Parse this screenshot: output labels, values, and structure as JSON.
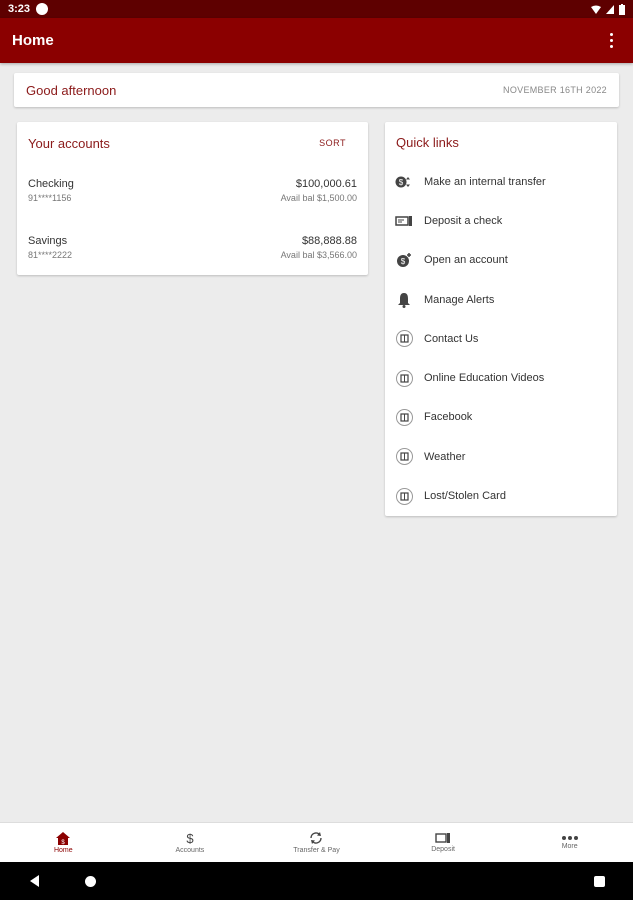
{
  "status": {
    "time": "3:23"
  },
  "app_bar": {
    "title": "Home"
  },
  "greeting": {
    "text": "Good afternoon",
    "date": "NOVEMBER 16TH 2022"
  },
  "accounts": {
    "title": "Your accounts",
    "sort_label": "SORT",
    "items": [
      {
        "name": "Checking",
        "number": "91****1156",
        "balance": "$100,000.61",
        "available": "Avail bal $1,500.00"
      },
      {
        "name": "Savings",
        "number": "81****2222",
        "balance": "$88,888.88",
        "available": "Avail bal $3,566.00"
      }
    ]
  },
  "quick_links": {
    "title": "Quick links",
    "items": [
      {
        "label": "Make an internal transfer",
        "icon": "transfer-icon"
      },
      {
        "label": "Deposit a check",
        "icon": "check-deposit-icon"
      },
      {
        "label": "Open an account",
        "icon": "open-account-icon"
      },
      {
        "label": "Manage Alerts",
        "icon": "bell-icon"
      },
      {
        "label": "Contact Us",
        "icon": "link-icon"
      },
      {
        "label": "Online Education Videos",
        "icon": "link-icon"
      },
      {
        "label": "Facebook",
        "icon": "link-icon"
      },
      {
        "label": "Weather",
        "icon": "link-icon"
      },
      {
        "label": "Lost/Stolen Card",
        "icon": "link-icon"
      }
    ]
  },
  "bottom_nav": {
    "items": [
      {
        "label": "Home",
        "icon": "home-icon",
        "active": true
      },
      {
        "label": "Accounts",
        "icon": "dollar-icon",
        "active": false
      },
      {
        "label": "Transfer & Pay",
        "icon": "transfer-pay-icon",
        "active": false
      },
      {
        "label": "Deposit",
        "icon": "deposit-icon",
        "active": false
      },
      {
        "label": "More",
        "icon": "more-icon",
        "active": false
      }
    ]
  },
  "colors": {
    "brand": "#8b0000",
    "status_bar": "#5e0000",
    "background": "#ececec"
  }
}
